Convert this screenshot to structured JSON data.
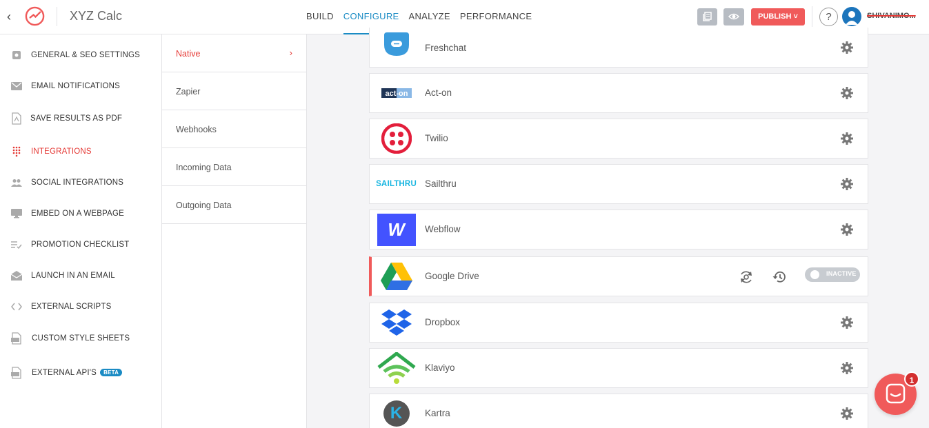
{
  "header": {
    "app_title": "XYZ Calc",
    "nav": [
      "BUILD",
      "CONFIGURE",
      "ANALYZE",
      "PERFORMANCE"
    ],
    "active_nav": "CONFIGURE",
    "publish_label": "PUBLISH",
    "help_label": "?",
    "username": "SHIVANIMO..."
  },
  "sidebar": {
    "items": [
      {
        "label": "GENERAL & SEO SETTINGS",
        "icon": "settings-icon"
      },
      {
        "label": "EMAIL NOTIFICATIONS",
        "icon": "mail-icon"
      },
      {
        "label": "SAVE RESULTS AS PDF",
        "icon": "pdf-icon"
      },
      {
        "label": "INTEGRATIONS",
        "icon": "integrations-icon",
        "active": true
      },
      {
        "label": "SOCIAL INTEGRATIONS",
        "icon": "people-icon"
      },
      {
        "label": "EMBED ON A WEBPAGE",
        "icon": "monitor-icon"
      },
      {
        "label": "PROMOTION CHECKLIST",
        "icon": "checklist-icon"
      },
      {
        "label": "LAUNCH IN AN EMAIL",
        "icon": "envelope-open-icon"
      },
      {
        "label": "EXTERNAL SCRIPTS",
        "icon": "code-icon"
      },
      {
        "label": "CUSTOM STYLE SHEETS",
        "icon": "css-file-icon"
      },
      {
        "label": "EXTERNAL API'S",
        "icon": "api-file-icon",
        "badge": "BETA"
      }
    ]
  },
  "subnav": {
    "items": [
      {
        "label": "Native",
        "active": true
      },
      {
        "label": "Zapier"
      },
      {
        "label": "Webhooks"
      },
      {
        "label": "Incoming Data"
      },
      {
        "label": "Outgoing Data"
      }
    ]
  },
  "integrations": [
    {
      "name": "Freshchat",
      "logo": "freshchat-logo"
    },
    {
      "name": "Act-on",
      "logo": "act-on-logo",
      "logo_text": "act-on"
    },
    {
      "name": "Twilio",
      "logo": "twilio-logo"
    },
    {
      "name": "Sailthru",
      "logo": "sailthru-logo",
      "logo_text": "SAILTHRU"
    },
    {
      "name": "Webflow",
      "logo": "webflow-logo",
      "logo_text": "W"
    },
    {
      "name": "Google Drive",
      "logo": "google-drive-logo",
      "status": "INACTIVE",
      "highlighted": true
    },
    {
      "name": "Dropbox",
      "logo": "dropbox-logo"
    },
    {
      "name": "Klaviyo",
      "logo": "klaviyo-logo"
    },
    {
      "name": "Kartra",
      "logo": "kartra-logo",
      "logo_text": "K"
    }
  ],
  "chat": {
    "badge_count": "1"
  },
  "colors": {
    "accent_red": "#f05a5a",
    "active_blue": "#1a8bc4",
    "border": "#e3e3e6",
    "background": "#f4f4f6"
  }
}
